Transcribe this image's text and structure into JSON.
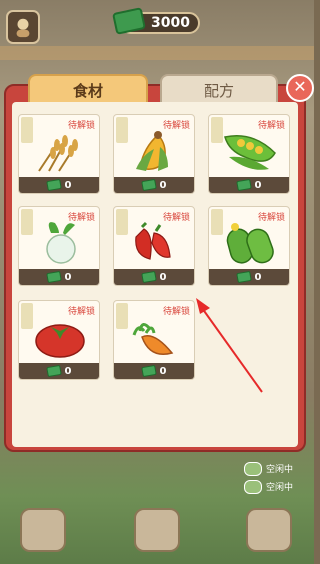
{
  "header": {
    "money": "3000"
  },
  "tabs": [
    {
      "label": "食材"
    },
    {
      "label": "配方"
    }
  ],
  "close_glyph": "✕",
  "cards": [
    {
      "name": "wheat-icon",
      "status": "待解锁",
      "count": "0"
    },
    {
      "name": "corn-icon",
      "status": "待解锁",
      "count": "0"
    },
    {
      "name": "peas-icon",
      "status": "待解锁",
      "count": "0"
    },
    {
      "name": "radish-icon",
      "status": "待解锁",
      "count": "0"
    },
    {
      "name": "pepper-icon",
      "status": "待解锁",
      "count": "0"
    },
    {
      "name": "cucumber-icon",
      "status": "待解锁",
      "count": "0"
    },
    {
      "name": "tomato-icon",
      "status": "待解锁",
      "count": "0"
    },
    {
      "name": "carrot-icon",
      "status": "待解锁",
      "count": "0"
    }
  ],
  "side_status": [
    "空闲中",
    "空闲中"
  ],
  "colors": {
    "panel": "#c8453d",
    "tab_active": "#f4c87a",
    "locked_text": "#d8443a"
  }
}
